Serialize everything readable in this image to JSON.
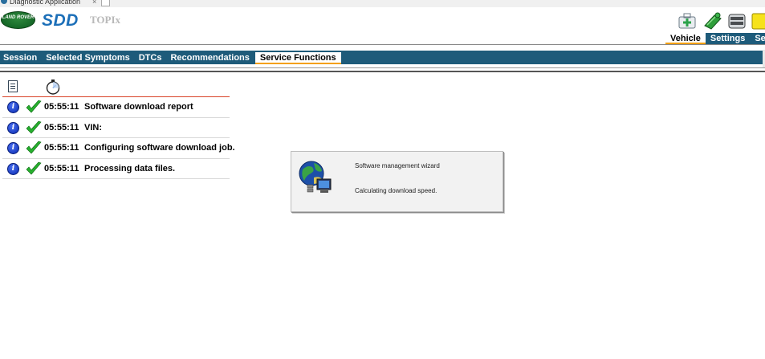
{
  "window": {
    "tab_title": "Diagnostic Application",
    "close_glyph": "×"
  },
  "brand": {
    "logo_text": "LAND ROVER",
    "product": "SDD",
    "sub_product": "TOPIx"
  },
  "toolbar": {
    "icons": [
      "first-aid-kit-icon",
      "green-tools-icon",
      "server-icon",
      "yellow-note-icon"
    ]
  },
  "right_tabs": [
    {
      "label": "Vehicle",
      "active": true
    },
    {
      "label": "Settings",
      "active": false
    },
    {
      "label": "Se",
      "active": false
    }
  ],
  "nav_tabs": [
    {
      "label": "Session",
      "active": false
    },
    {
      "label": "Selected Symptoms",
      "active": false
    },
    {
      "label": "DTCs",
      "active": false
    },
    {
      "label": "Recommendations",
      "active": false
    },
    {
      "label": "Service Functions",
      "active": true
    }
  ],
  "log": {
    "header_icons": [
      "document-icon",
      "stopwatch-icon"
    ],
    "rows": [
      {
        "time": "05:55:11",
        "text": "Software download report"
      },
      {
        "time": "05:55:11",
        "text": "VIN:"
      },
      {
        "time": "05:55:11",
        "text": "Configuring software download job."
      },
      {
        "time": "05:55:11",
        "text": "Processing data files."
      }
    ]
  },
  "wizard": {
    "title": "Software management wizard",
    "status": "Calculating download speed.",
    "icon": "globe-computer-icon"
  },
  "colors": {
    "nav_bg": "#1e5b7a",
    "active_underline": "#f3a012",
    "header_rule": "#d9442a",
    "sdd_blue": "#1c6fb8"
  }
}
